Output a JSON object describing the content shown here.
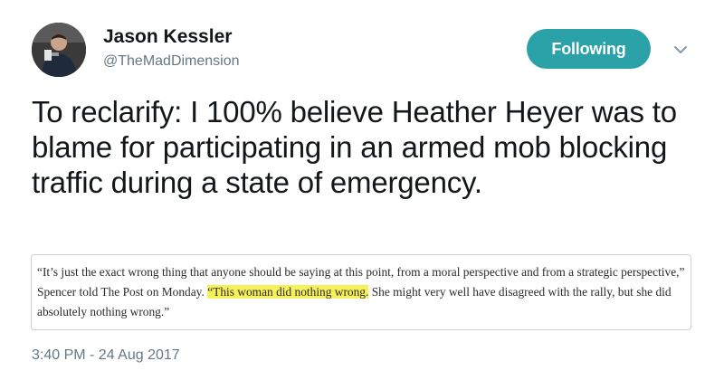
{
  "author": {
    "name": "Jason Kessler",
    "handle": "@TheMadDimension",
    "avatar_icon": "user-avatar"
  },
  "follow_button": {
    "label": "Following",
    "color": "#2ba1a8"
  },
  "menu_icon": "chevron-down-icon",
  "tweet": {
    "text": "To reclarify: I 100% believe Heather Heyer was to blame for participating in an armed mob blocking traffic during a state of emergency."
  },
  "quote_image": {
    "before": "“It’s just the exact wrong thing that anyone should be saying at this point, from a moral perspective and from a strategic perspective,” Spencer told The Post on Monday. ",
    "highlighted": "“This woman did nothing wrong.",
    "after": " She might very well have disagreed with the rally, but she did absolutely nothing wrong.”",
    "highlight_color": "#f6f05a"
  },
  "timestamp": "3:40 PM - 24 Aug 2017"
}
